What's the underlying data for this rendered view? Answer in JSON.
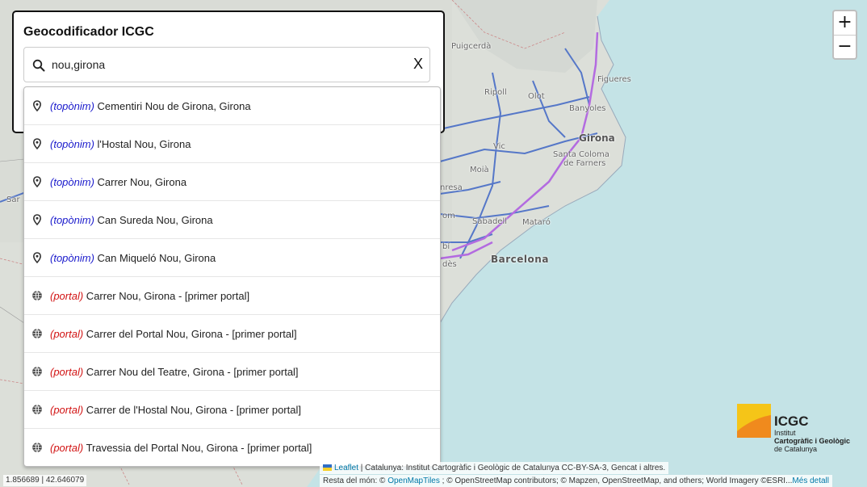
{
  "panel": {
    "title": "Geocodificador ICGC",
    "search_value": "nou,girona",
    "clear_label": "X"
  },
  "results": [
    {
      "type": "(topònim)",
      "kind": "toponim",
      "text": " Cementiri Nou de Girona, Girona",
      "icon": "map-pin-icon"
    },
    {
      "type": "(topònim)",
      "kind": "toponim",
      "text": " l'Hostal Nou, Girona",
      "icon": "map-pin-icon"
    },
    {
      "type": "(topònim)",
      "kind": "toponim",
      "text": " Carrer Nou, Girona",
      "icon": "map-pin-icon"
    },
    {
      "type": "(topònim)",
      "kind": "toponim",
      "text": " Can Sureda Nou, Girona",
      "icon": "map-pin-icon"
    },
    {
      "type": "(topònim)",
      "kind": "toponim",
      "text": " Can Miqueló Nou, Girona",
      "icon": "map-pin-icon"
    },
    {
      "type": "(portal)",
      "kind": "portal",
      "text": " Carrer Nou, Girona - [primer portal]",
      "icon": "globe-icon"
    },
    {
      "type": "(portal)",
      "kind": "portal",
      "text": " Carrer del Portal Nou, Girona - [primer portal]",
      "icon": "globe-icon"
    },
    {
      "type": "(portal)",
      "kind": "portal",
      "text": " Carrer Nou del Teatre, Girona - [primer portal]",
      "icon": "globe-icon"
    },
    {
      "type": "(portal)",
      "kind": "portal",
      "text": " Carrer de l'Hostal Nou, Girona - [primer portal]",
      "icon": "globe-icon"
    },
    {
      "type": "(portal)",
      "kind": "portal",
      "text": " Travessia del Portal Nou, Girona - [primer portal]",
      "icon": "globe-icon"
    }
  ],
  "zoom": {
    "in_label": "+",
    "out_label": "−"
  },
  "logo": {
    "name": "ICGC",
    "line1": "Institut",
    "line2": "Cartogràfic i Geològic",
    "line3": "de Catalunya"
  },
  "map_labels": {
    "girona": "Girona",
    "barcelona": "Barcelona",
    "figueres": "Figueres",
    "banyoles": "Banyoles",
    "olot": "Olot",
    "ripoll": "Ripoll",
    "puigcerda": "Puigcerdà",
    "vic": "Vic",
    "santa_coloma": "Santa Coloma",
    "de_farners": "de Farners",
    "moia": "Moià",
    "manresa": "nresa",
    "sabadell": "Sabadell",
    "mataro": "Mataró",
    "sar": "Sar",
    "rubi": "bí",
    "cornella": "dès",
    "om": "om"
  },
  "coords": "1.856689 | 42.646079",
  "attribution": {
    "leaflet": "Leaflet",
    "line1_rest": " | Catalunya: Institut Cartogràfic i Geològic de Catalunya CC-BY-SA-3, Gencat i altres.",
    "line2_prefix": "Resta del món: © ",
    "openmaptiles": "OpenMapTiles",
    "line2_rest": " ; © OpenStreetMap contributors; © Mapzen, OpenStreetMap, and others; World Imagery ©ESRI...",
    "mes_detall": "Més detall"
  },
  "colors": {
    "sea": "#c4e3e6",
    "land": "#dcdfd9",
    "road_blue": "#5577c8",
    "road_purple": "#b36be0",
    "toponim": "#1a1acc",
    "portal": "#d21414",
    "logo_yellow": "#f5c518",
    "logo_orange": "#f08a1d"
  }
}
